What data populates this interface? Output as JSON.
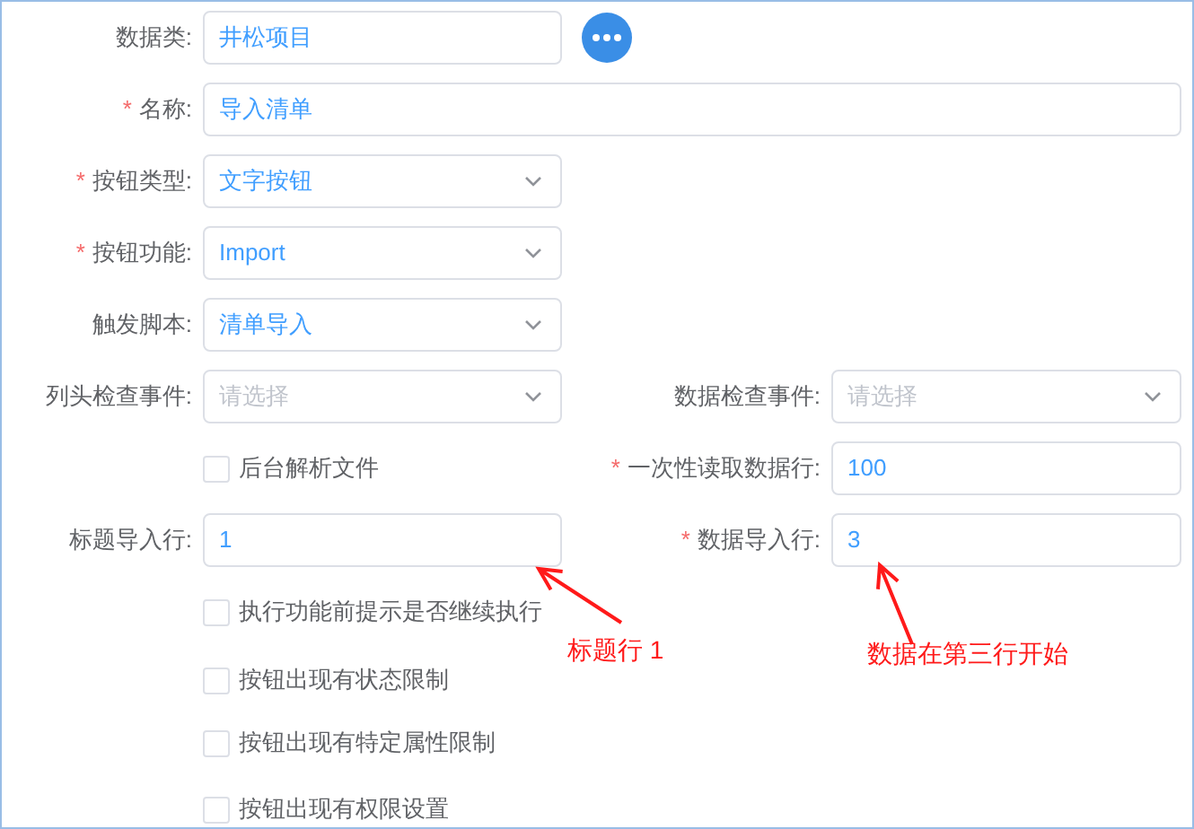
{
  "rows": [
    {
      "left": {
        "kind": "input",
        "label": "数据类:",
        "value": "井松项目"
      },
      "more_button": true
    },
    {
      "left": {
        "kind": "input",
        "mark": "*",
        "label": "名称:",
        "value": "导入清单",
        "wide": true
      }
    },
    {
      "left": {
        "kind": "select",
        "mark": "*",
        "label": "按钮类型:",
        "value": "文字按钮"
      }
    },
    {
      "left": {
        "kind": "select",
        "mark": "*",
        "label": "按钮功能:",
        "value": "Import"
      }
    },
    {
      "left": {
        "kind": "select",
        "label": "触发脚本:",
        "value": "清单导入"
      }
    },
    {
      "left": {
        "kind": "select",
        "label": "列头检查事件:",
        "placeholder": "请选择"
      },
      "right": {
        "kind": "select",
        "label": "数据检查事件:",
        "placeholder": "请选择"
      }
    },
    {
      "left": {
        "kind": "checkbox",
        "label": "后台解析文件",
        "checked": false
      },
      "right": {
        "kind": "input",
        "mark": "*",
        "label": "一次性读取数据行:",
        "value": "100"
      }
    },
    {
      "left": {
        "kind": "input",
        "label": "标题导入行:",
        "value": "1"
      },
      "right": {
        "kind": "input",
        "mark": "*",
        "label": "数据导入行:",
        "value": "3"
      }
    },
    {
      "left": {
        "kind": "checkbox",
        "label": "执行功能前提示是否继续执行",
        "checked": false
      }
    },
    {
      "left": {
        "kind": "checkbox",
        "label": "按钮出现有状态限制",
        "checked": false
      }
    },
    {
      "left": {
        "kind": "checkbox",
        "label": "按钮出现有特定属性限制",
        "checked": false
      }
    },
    {
      "left": {
        "kind": "checkbox",
        "label": "按钮出现有权限设置",
        "checked": false
      }
    }
  ],
  "annotations": [
    {
      "text": "标题行 1"
    },
    {
      "text": "数据在第三行开始"
    }
  ]
}
